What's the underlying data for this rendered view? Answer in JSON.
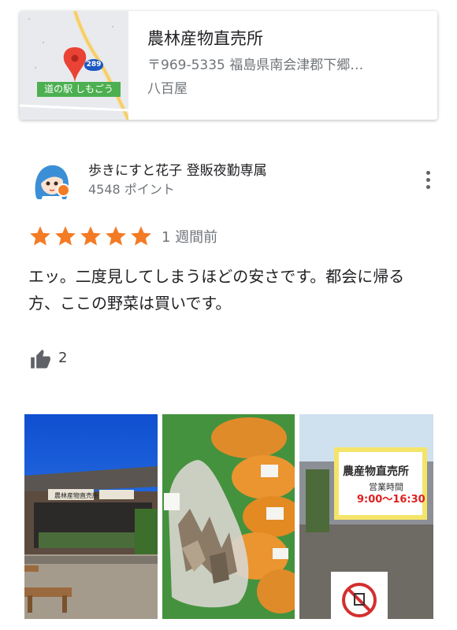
{
  "place": {
    "name": "農林産物直売所",
    "address": "〒969-5335 福島県南会津郡下郷…",
    "category": "八百屋",
    "map": {
      "poi_label": "道の駅 しもごう",
      "route_number": "289"
    }
  },
  "review": {
    "author": "歩きにすと花子 登販夜勤専属",
    "points": "4548 ポイント",
    "rating": 5,
    "date": "1 週間前",
    "text": "エッ。二度見してしまうほどの安さです。都会に帰る方、ここの野菜は買いです。",
    "like_count": "2"
  },
  "photos": {
    "photo1_sign": "農林産物直売所",
    "photo3_sign_title": "農産物直売所",
    "photo3_sign_subtitle": "営業時間",
    "photo3_sign_hours": "9:00〜16:30"
  },
  "colors": {
    "star": "#f37b25",
    "secondary_text": "#70757a",
    "map_pin": "#ea4335",
    "route_badge": "#1a57c4"
  },
  "icons": {
    "like": "thumbs-up-icon",
    "more": "more-vert-icon",
    "star": "star-icon",
    "pin": "map-pin-icon"
  }
}
